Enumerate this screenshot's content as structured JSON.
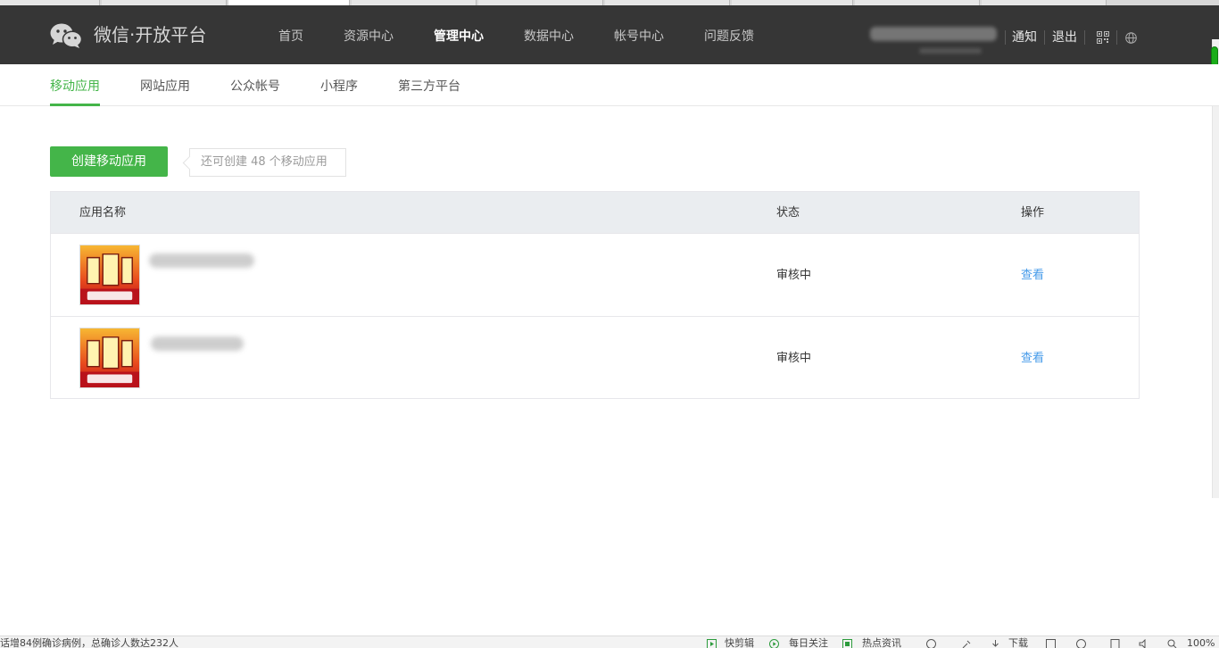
{
  "topbar": {
    "logo_text": "微信·开放平台",
    "nav": [
      {
        "label": "首页",
        "active": false
      },
      {
        "label": "资源中心",
        "active": false
      },
      {
        "label": "管理中心",
        "active": true
      },
      {
        "label": "数据中心",
        "active": false
      },
      {
        "label": "帐号中心",
        "active": false
      },
      {
        "label": "问题反馈",
        "active": false
      }
    ],
    "notify_label": "通知",
    "logout_label": "退出"
  },
  "subnav": {
    "tabs": [
      {
        "label": "移动应用",
        "active": true
      },
      {
        "label": "网站应用",
        "active": false
      },
      {
        "label": "公众帐号",
        "active": false
      },
      {
        "label": "小程序",
        "active": false
      },
      {
        "label": "第三方平台",
        "active": false
      }
    ]
  },
  "actions": {
    "create_label": "创建移动应用",
    "quota_text": "还可创建 48 个移动应用"
  },
  "table": {
    "headers": {
      "name": "应用名称",
      "status": "状态",
      "action": "操作"
    },
    "rows": [
      {
        "status": "审核中",
        "action": "查看"
      },
      {
        "status": "审核中",
        "action": "查看"
      }
    ]
  },
  "statusbar": {
    "left_text": "话增84例确诊病例，总确诊人数达232人",
    "items": [
      "快剪辑",
      "每日关注",
      "热点资讯",
      "下载",
      "100%"
    ]
  },
  "colors": {
    "accent": "#44b549",
    "topbar_bg": "#363636",
    "link": "#459ae9"
  }
}
